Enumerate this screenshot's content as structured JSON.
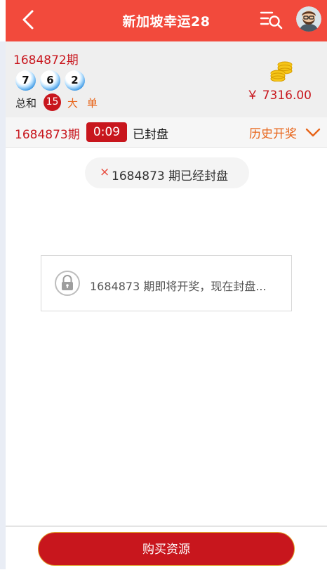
{
  "header": {
    "title": "新加坡幸运28",
    "back_icon": "chevron-left-icon",
    "menu_icon": "list-search-icon",
    "avatar": "bearded-man-avatar",
    "background": "#f24a3c"
  },
  "last_draw": {
    "issue": "1684872期",
    "balls": [
      "7",
      "6",
      "2"
    ],
    "sum_label": "总和",
    "sum_value": "15",
    "size": "大",
    "parity": "单",
    "balance": "￥ 7316.00",
    "coins_icon": "gold-coins-icon"
  },
  "status": {
    "current_issue": "1684873期",
    "countdown": "0:09",
    "state": "已封盘",
    "history_label": "历史开奖",
    "accent": "#c8161d",
    "history_color": "#e8651a"
  },
  "toast": {
    "icon": "×",
    "text": "1684873 期已经封盘"
  },
  "notice": {
    "icon": "lock-icon",
    "text": "1684873 期即将开奖，现在封盘..."
  },
  "footer": {
    "buy_label": "购买资源"
  }
}
